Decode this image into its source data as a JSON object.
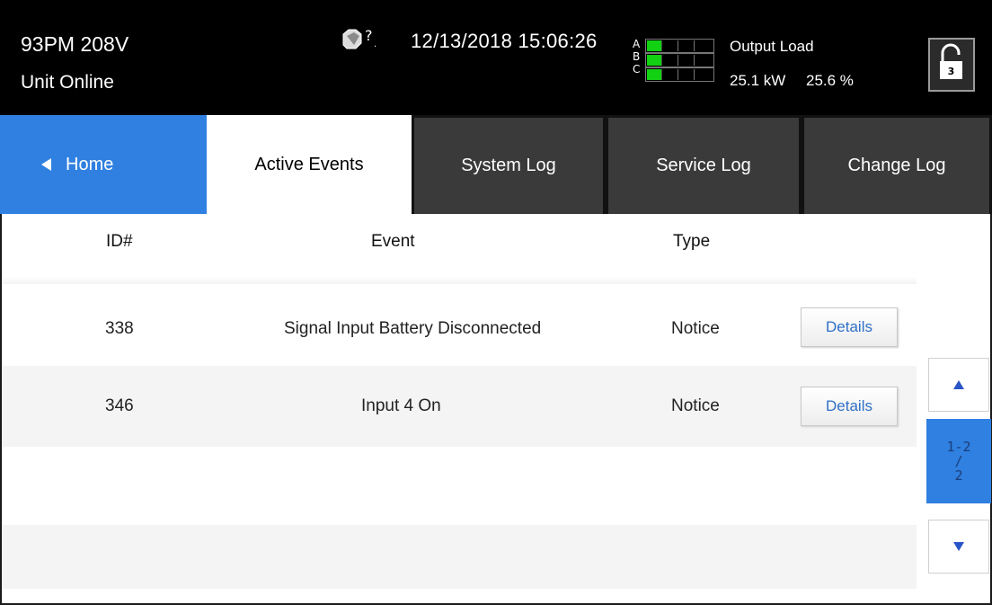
{
  "header": {
    "unit_model": "93PM 208V",
    "unit_status": "Unit Online",
    "help_icon": "help-question-icon",
    "datetime": "12/13/2018 15:06:26",
    "phases": [
      {
        "label": "A",
        "active_segments": 1
      },
      {
        "label": "B",
        "active_segments": 1
      },
      {
        "label": "C",
        "active_segments": 1
      }
    ],
    "output": {
      "title": "Output Load",
      "kw": "25.1 kW",
      "percent": "25.6 %"
    },
    "lock": {
      "icon": "unlocked-padlock-icon",
      "level": "3"
    }
  },
  "tabs": [
    {
      "label": "Home",
      "icon": "back-triangle-icon"
    },
    {
      "label": "Active Events"
    },
    {
      "label": "System Log"
    },
    {
      "label": "Service Log"
    },
    {
      "label": "Change Log"
    }
  ],
  "table": {
    "columns": [
      "ID#",
      "Event",
      "Type"
    ],
    "rows": [
      {
        "id": "338",
        "event": "Signal Input Battery Disconnected",
        "type": "Notice",
        "action": "Details"
      },
      {
        "id": "346",
        "event": "Input 4 On",
        "type": "Notice",
        "action": "Details"
      }
    ]
  },
  "pager": {
    "indicator_lines": [
      "1-2",
      "/",
      "2"
    ],
    "up_icon": "up-arrow-icon",
    "down_icon": "down-arrow-icon"
  },
  "colors": {
    "header_bg": "#000000",
    "accent_blue": "#2f80e0",
    "status_green": "#12d012",
    "tab_dark": "#3a3a3a",
    "link_blue": "#2f6fc7"
  }
}
